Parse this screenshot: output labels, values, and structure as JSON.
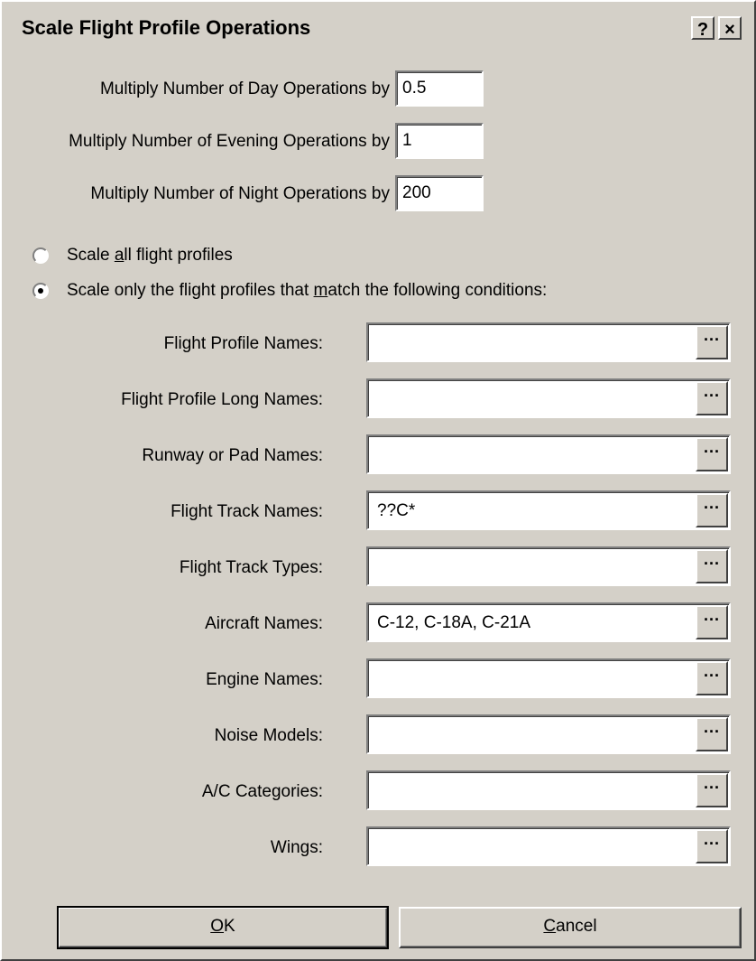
{
  "dialog": {
    "title": "Scale Flight Profile Operations",
    "help_label": "?",
    "close_label": "×"
  },
  "multipliers": [
    {
      "label": "Multiply Number of Day Operations by",
      "value": "0.5"
    },
    {
      "label": "Multiply Number of Evening Operations by",
      "value": "1"
    },
    {
      "label": "Multiply Number of Night Operations by",
      "value": "200"
    }
  ],
  "scope": {
    "all": {
      "pre": "Scale ",
      "underline": "a",
      "post": "ll flight profiles",
      "selected": false
    },
    "match": {
      "pre": "Scale only the flight profiles that ",
      "underline": "m",
      "post": "atch the following conditions:",
      "selected": true
    }
  },
  "conditions": [
    {
      "label": "Flight Profile Names:",
      "value": ""
    },
    {
      "label": "Flight Profile Long Names:",
      "value": ""
    },
    {
      "label": "Runway or Pad Names:",
      "value": ""
    },
    {
      "label": "Flight Track Names:",
      "value": "??C*"
    },
    {
      "label": "Flight Track Types:",
      "value": ""
    },
    {
      "label": "Aircraft Names:",
      "value": "C-12, C-18A, C-21A"
    },
    {
      "label": "Engine Names:",
      "value": ""
    },
    {
      "label": "Noise Models:",
      "value": ""
    },
    {
      "label": "A/C Categories:",
      "value": ""
    },
    {
      "label": "Wings:",
      "value": ""
    }
  ],
  "browse_label": "···",
  "buttons": {
    "ok": {
      "underline": "O",
      "rest": "K"
    },
    "cancel": {
      "underline": "C",
      "rest": "ancel"
    }
  }
}
